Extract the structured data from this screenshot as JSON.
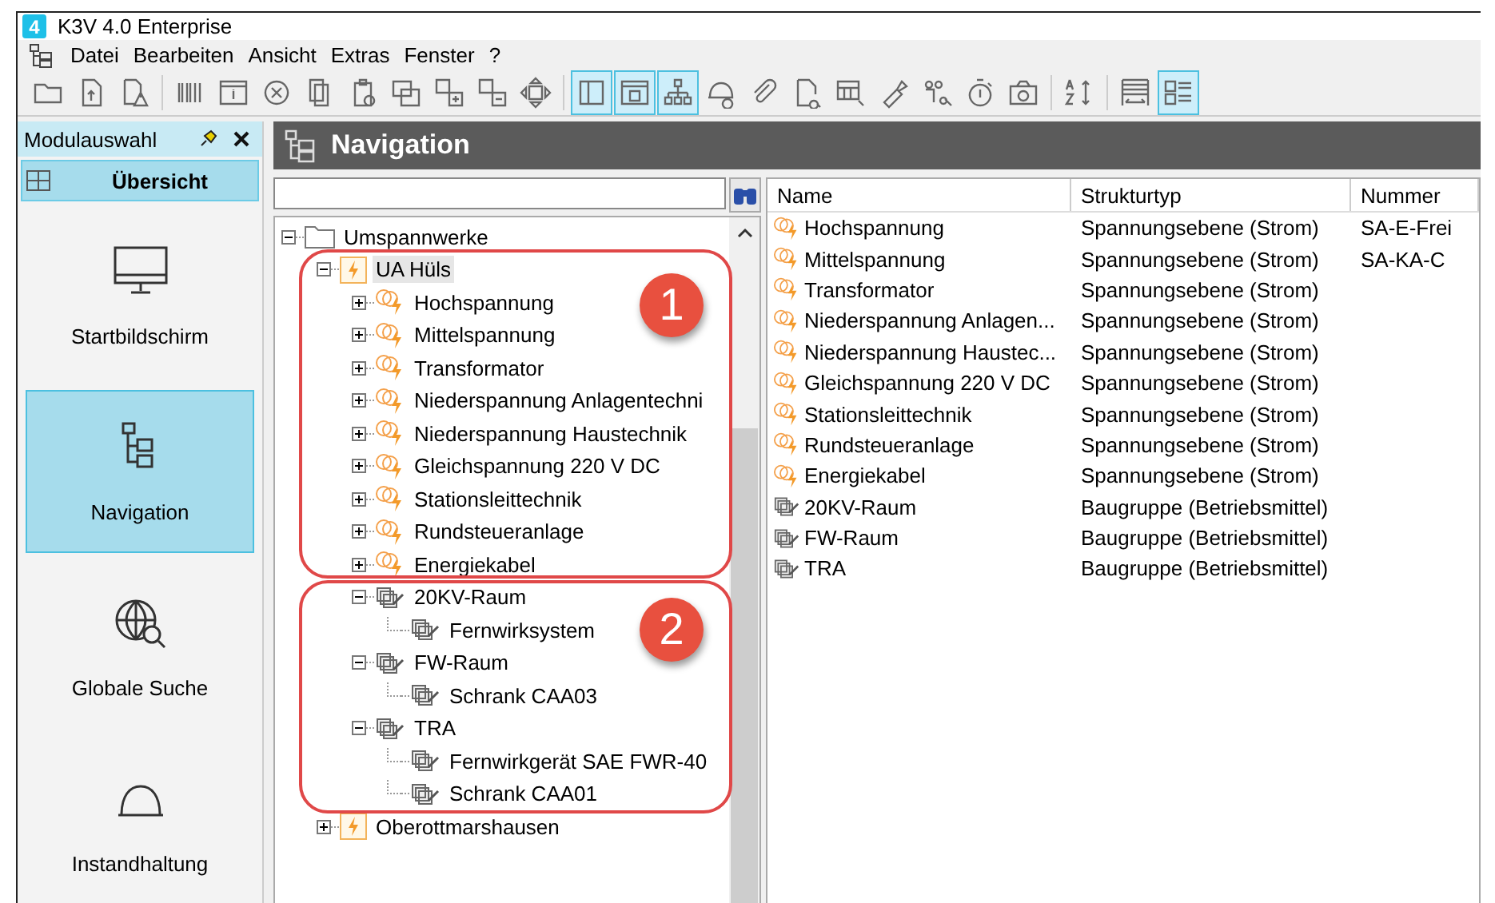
{
  "window": {
    "title": "K3V 4.0 Enterprise",
    "app_icon": "4"
  },
  "menu": [
    "Datei",
    "Bearbeiten",
    "Ansicht",
    "Extras",
    "Fenster",
    "?"
  ],
  "toolbar": [
    {
      "selected": false
    },
    {
      "selected": false
    },
    {
      "selected": false
    },
    {
      "selected": false
    },
    {
      "selected": false
    },
    {
      "selected": false
    },
    {
      "selected": false
    },
    {
      "selected": false
    },
    {
      "selected": false
    },
    {
      "selected": false
    },
    {
      "selected": false
    },
    {
      "selected": false
    },
    {
      "selected": true
    },
    {
      "selected": true
    },
    {
      "selected": true
    },
    {
      "selected": false
    },
    {
      "selected": false
    },
    {
      "selected": false
    },
    {
      "selected": false
    },
    {
      "selected": false
    },
    {
      "selected": false
    },
    {
      "selected": false
    },
    {
      "selected": false
    },
    {
      "selected": false
    },
    {
      "selected": false
    },
    {
      "selected": true
    }
  ],
  "sidebar": {
    "title": "Modulauswahl",
    "tab": "Übersicht",
    "items": [
      {
        "label": "Startbildschirm",
        "selected": false
      },
      {
        "label": "Navigation",
        "selected": true
      },
      {
        "label": "Globale Suche",
        "selected": false
      },
      {
        "label": "Instandhaltung",
        "selected": false
      }
    ]
  },
  "panel": {
    "title": "Navigation",
    "tree": [
      {
        "label": "Umspannwerke",
        "kind": "folder",
        "expanded": true,
        "selected": false,
        "children": [
          {
            "label": "UA Hüls",
            "kind": "station",
            "expanded": true,
            "selected": true,
            "children": [
              {
                "label": "Hochspannung",
                "kind": "voltage",
                "expanded": false,
                "selected": false
              },
              {
                "label": "Mittelspannung",
                "kind": "voltage",
                "expanded": false,
                "selected": false
              },
              {
                "label": "Transformator",
                "kind": "voltage",
                "expanded": false,
                "selected": false
              },
              {
                "label": "Niederspannung Anlagentechni",
                "kind": "voltage",
                "expanded": false,
                "selected": false
              },
              {
                "label": "Niederspannung Haustechnik",
                "kind": "voltage",
                "expanded": false,
                "selected": false
              },
              {
                "label": "Gleichspannung 220 V DC",
                "kind": "voltage",
                "expanded": false,
                "selected": false
              },
              {
                "label": "Stationsleittechnik",
                "kind": "voltage",
                "expanded": false,
                "selected": false
              },
              {
                "label": "Rundsteueranlage",
                "kind": "voltage",
                "expanded": false,
                "selected": false
              },
              {
                "label": "Energiekabel",
                "kind": "voltage",
                "expanded": false,
                "selected": false
              },
              {
                "label": "20KV-Raum",
                "kind": "assembly",
                "expanded": true,
                "selected": false,
                "children": [
                  {
                    "label": "Fernwirksystem",
                    "kind": "assembly",
                    "selected": false
                  }
                ]
              },
              {
                "label": "FW-Raum",
                "kind": "assembly",
                "expanded": true,
                "selected": false,
                "children": [
                  {
                    "label": "Schrank CAA03",
                    "kind": "assembly",
                    "selected": false
                  }
                ]
              },
              {
                "label": "TRA",
                "kind": "assembly",
                "expanded": true,
                "selected": false,
                "children": [
                  {
                    "label": "Fernwirkgerät SAE FWR-40",
                    "kind": "assembly",
                    "selected": false
                  },
                  {
                    "label": "Schrank CAA01",
                    "kind": "assembly",
                    "selected": false
                  }
                ]
              }
            ]
          },
          {
            "label": "Oberottmarshausen",
            "kind": "station",
            "expanded": false,
            "selected": false
          }
        ]
      }
    ],
    "callouts": [
      {
        "label": "1"
      },
      {
        "label": "2"
      }
    ],
    "list": {
      "columns": [
        "Name",
        "Strukturtyp",
        "Nummer"
      ],
      "rows": [
        {
          "kind": "voltage",
          "name": "Hochspannung",
          "type": "Spannungsebene (Strom)",
          "number": "SA-E-Frei"
        },
        {
          "kind": "voltage",
          "name": "Mittelspannung",
          "type": "Spannungsebene (Strom)",
          "number": "SA-KA-C"
        },
        {
          "kind": "voltage",
          "name": "Transformator",
          "type": "Spannungsebene (Strom)"
        },
        {
          "kind": "voltage",
          "name": "Niederspannung Anlagen...",
          "type": "Spannungsebene (Strom)"
        },
        {
          "kind": "voltage",
          "name": "Niederspannung Haustec...",
          "type": "Spannungsebene (Strom)"
        },
        {
          "kind": "voltage",
          "name": "Gleichspannung 220 V DC",
          "type": "Spannungsebene (Strom)"
        },
        {
          "kind": "voltage",
          "name": "Stationsleittechnik",
          "type": "Spannungsebene (Strom)"
        },
        {
          "kind": "voltage",
          "name": "Rundsteueranlage",
          "type": "Spannungsebene (Strom)"
        },
        {
          "kind": "voltage",
          "name": "Energiekabel",
          "type": "Spannungsebene (Strom)"
        },
        {
          "kind": "assembly",
          "name": "20KV-Raum",
          "type": "Baugruppe (Betriebsmittel)"
        },
        {
          "kind": "assembly",
          "name": "FW-Raum",
          "type": "Baugruppe (Betriebsmittel)"
        },
        {
          "kind": "assembly",
          "name": "TRA",
          "type": "Baugruppe (Betriebsmittel)"
        }
      ]
    }
  }
}
